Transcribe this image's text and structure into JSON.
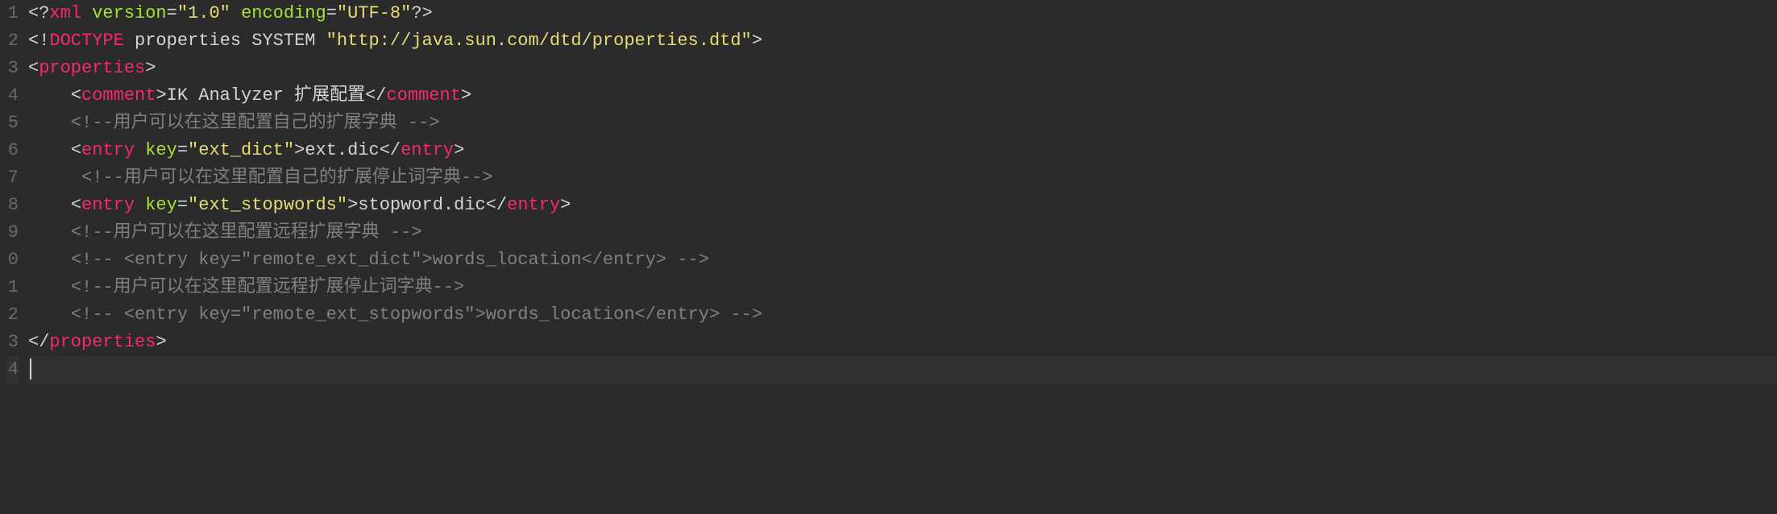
{
  "gutter": [
    "1",
    "2",
    "3",
    "4",
    "5",
    "6",
    "7",
    "8",
    "9",
    "0",
    "1",
    "2",
    "3",
    "4"
  ],
  "l1": {
    "piOpen": "<?",
    "xml": "xml",
    "verAttr": "version",
    "eq": "=",
    "verVal": "\"1.0\"",
    "encAttr": "encoding",
    "encVal": "\"UTF-8\"",
    "piClose": "?>"
  },
  "l2": {
    "open": "<!",
    "doctype": "DOCTYPE",
    "rest": " properties SYSTEM ",
    "dtd": "\"http://java.sun.com/dtd/properties.dtd\"",
    "close": ">"
  },
  "l3": {
    "lt": "<",
    "tag": "properties",
    "gt": ">"
  },
  "l4": {
    "lt": "<",
    "tag": "comment",
    "gt": ">",
    "text": "IK Analyzer 扩展配置",
    "lt2": "</",
    "tag2": "comment",
    "gt2": ">"
  },
  "l5": {
    "c": "<!--用户可以在这里配置自己的扩展字典 -->"
  },
  "l6": {
    "lt": "<",
    "tag": "entry",
    "sp": " ",
    "attr": "key",
    "eq": "=",
    "val": "\"ext_dict\"",
    "gt": ">",
    "text": "ext.dic",
    "lt2": "</",
    "tag2": "entry",
    "gt2": ">"
  },
  "l7": {
    "c": "<!--用户可以在这里配置自己的扩展停止词字典-->"
  },
  "l8": {
    "lt": "<",
    "tag": "entry",
    "sp": " ",
    "attr": "key",
    "eq": "=",
    "val": "\"ext_stopwords\"",
    "gt": ">",
    "text": "stopword.dic",
    "lt2": "</",
    "tag2": "entry",
    "gt2": ">"
  },
  "l9": {
    "c": "<!--用户可以在这里配置远程扩展字典 -->"
  },
  "l10": {
    "c": "<!-- <entry key=\"remote_ext_dict\">words_location</entry> -->"
  },
  "l11": {
    "c": "<!--用户可以在这里配置远程扩展停止词字典-->"
  },
  "l12": {
    "c": "<!-- <entry key=\"remote_ext_stopwords\">words_location</entry> -->"
  },
  "l13": {
    "lt": "</",
    "tag": "properties",
    "gt": ">"
  }
}
